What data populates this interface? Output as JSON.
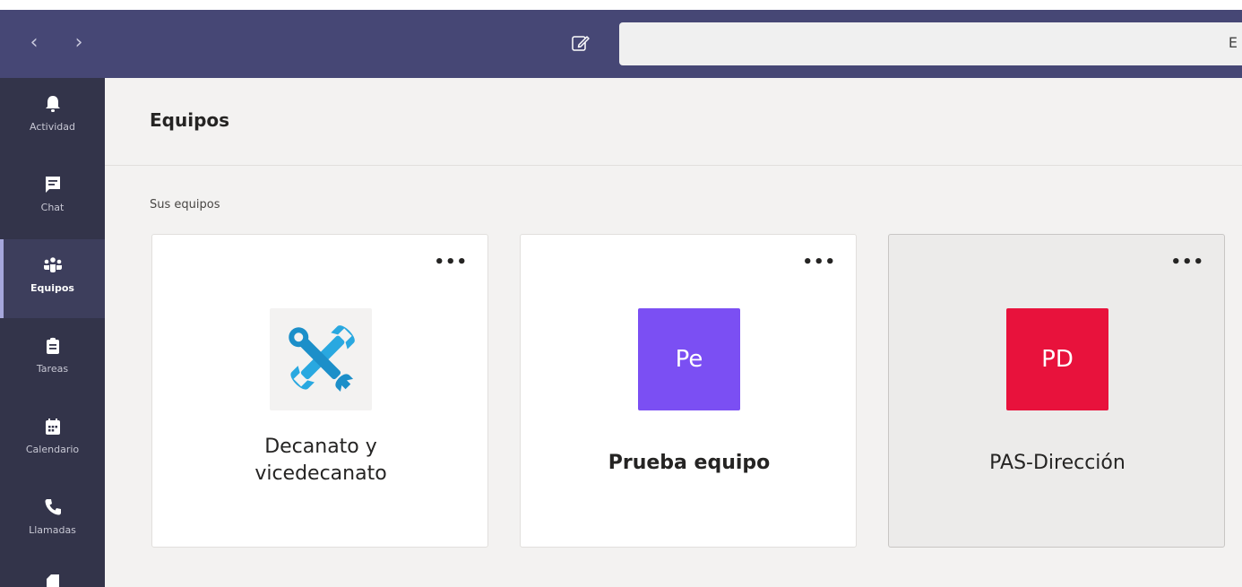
{
  "topbar": {
    "back_icon": "chevron-left-icon",
    "forward_icon": "chevron-right-icon",
    "compose_icon": "compose-icon",
    "search_placeholder": "E",
    "colors": {
      "bar": "#464775"
    }
  },
  "rail": {
    "items": [
      {
        "label": "Actividad",
        "icon": "bell-icon"
      },
      {
        "label": "Chat",
        "icon": "chat-icon"
      },
      {
        "label": "Equipos",
        "icon": "teams-icon",
        "active": true
      },
      {
        "label": "Tareas",
        "icon": "assignments-icon"
      },
      {
        "label": "Calendario",
        "icon": "calendar-icon"
      },
      {
        "label": "Llamadas",
        "icon": "phone-icon"
      }
    ]
  },
  "main": {
    "title": "Equipos",
    "section_label": "Sus equipos",
    "teams": [
      {
        "name": "Decanato y vicedecanato",
        "name_line1": "Decanato y",
        "name_line2": "vicedecanato",
        "avatar_icon": "tools-icon",
        "more": "•••"
      },
      {
        "name": "Prueba equipo",
        "initials": "Pe",
        "avatar_color": "#7b4ff3",
        "more": "•••"
      },
      {
        "name": "PAS-Dirección",
        "initials": "PD",
        "avatar_color": "#e8123c",
        "more": "•••"
      }
    ]
  }
}
